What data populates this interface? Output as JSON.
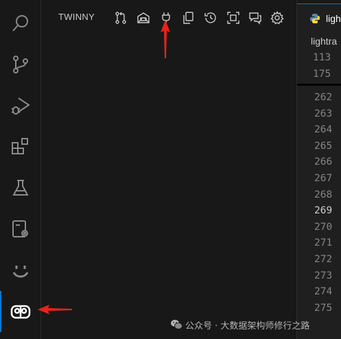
{
  "panel": {
    "title": "TWINNY",
    "tools": [
      {
        "icon": "git-pull-request-icon"
      },
      {
        "icon": "chat-robot-icon"
      },
      {
        "icon": "plug-icon"
      },
      {
        "icon": "copy-icon"
      },
      {
        "icon": "history-icon"
      },
      {
        "icon": "fullscreen-icon"
      },
      {
        "icon": "chat-bubbles-icon"
      },
      {
        "icon": "gear-icon"
      }
    ]
  },
  "activity_bar": {
    "items": [
      {
        "icon": "search-icon"
      },
      {
        "icon": "source-control-icon"
      },
      {
        "icon": "run-debug-icon"
      },
      {
        "icon": "extensions-icon"
      },
      {
        "icon": "testing-flask-icon"
      },
      {
        "icon": "remote-explorer-icon"
      },
      {
        "icon": "smiley-icon"
      },
      {
        "icon": "twinny-icon",
        "active": true
      }
    ]
  },
  "editor": {
    "tab_label": "ligh",
    "breadcrumb": "lightra",
    "sticky_lines": [
      "113",
      "175"
    ],
    "line_numbers": [
      "262",
      "263",
      "264",
      "265",
      "266",
      "267",
      "268",
      "269",
      "270",
      "271",
      "272",
      "273",
      "274",
      "275"
    ],
    "current_line": "269"
  },
  "watermark": {
    "text": "公众号 · 大数据架构师修行之路"
  },
  "colors": {
    "accent": "#0078d4",
    "annotation_arrow": "#e8231b"
  }
}
